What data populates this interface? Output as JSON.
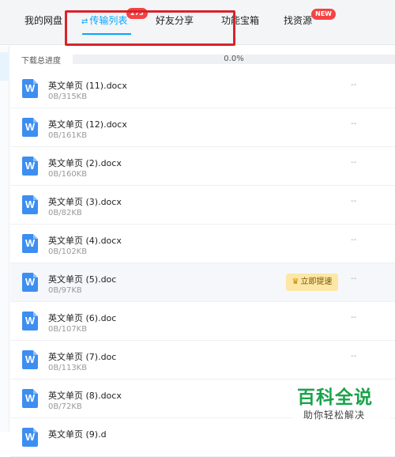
{
  "tabs": [
    {
      "label": "我的网盘"
    },
    {
      "label": "传输列表",
      "badge": "275"
    },
    {
      "label": "好友分享"
    },
    {
      "label": "功能宝箱"
    },
    {
      "label": "找资源",
      "badge": "NEW"
    }
  ],
  "colors": {
    "accent": "#06a7ff",
    "badge": "#f54343",
    "highlight": "#d8232a",
    "word_icon": "#3d8ef0",
    "speedup_bg": "#fde7a6",
    "watermark": "#1aa34a"
  },
  "progress": {
    "label": "下载总进度",
    "value_text": "0.0%",
    "fraction": 0.0
  },
  "files": [
    {
      "icon": "word-icon",
      "icon_letter": "W",
      "name": "英文单页 (11).docx",
      "size": "0B/315KB",
      "status": "--"
    },
    {
      "icon": "word-icon",
      "icon_letter": "W",
      "name": "英文单页 (12).docx",
      "size": "0B/161KB",
      "status": "--"
    },
    {
      "icon": "word-icon",
      "icon_letter": "W",
      "name": "英文单页 (2).docx",
      "size": "0B/160KB",
      "status": "--"
    },
    {
      "icon": "word-icon",
      "icon_letter": "W",
      "name": "英文单页 (3).docx",
      "size": "0B/82KB",
      "status": "--"
    },
    {
      "icon": "word-icon",
      "icon_letter": "W",
      "name": "英文单页 (4).docx",
      "size": "0B/102KB",
      "status": "--"
    },
    {
      "icon": "word-icon",
      "icon_letter": "W",
      "name": "英文单页 (5).doc",
      "size": "0B/97KB",
      "status": "--",
      "action": "立即提速"
    },
    {
      "icon": "word-icon",
      "icon_letter": "W",
      "name": "英文单页 (6).doc",
      "size": "0B/107KB",
      "status": "--"
    },
    {
      "icon": "word-icon",
      "icon_letter": "W",
      "name": "英文单页 (7).doc",
      "size": "0B/113KB",
      "status": "--"
    },
    {
      "icon": "word-icon",
      "icon_letter": "W",
      "name": "英文单页 (8).docx",
      "size": "0B/72KB",
      "status": ""
    },
    {
      "icon": "word-icon",
      "icon_letter": "W",
      "name": "英文单页 (9).d",
      "size": "",
      "status": ""
    }
  ],
  "watermark": {
    "title": "百科全说",
    "subtitle": "助你轻松解决"
  }
}
